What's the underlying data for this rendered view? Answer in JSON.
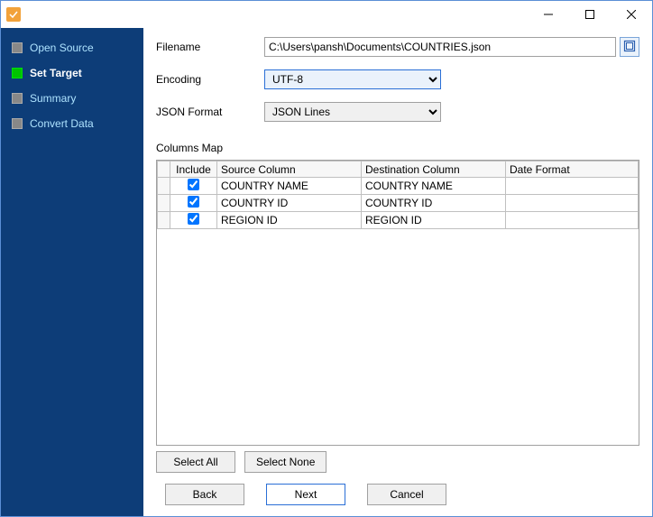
{
  "titlebar": {
    "title": ""
  },
  "sidebar": {
    "steps": [
      {
        "label": "Open Source",
        "active": false
      },
      {
        "label": "Set Target",
        "active": true
      },
      {
        "label": "Summary",
        "active": false
      },
      {
        "label": "Convert Data",
        "active": false
      }
    ]
  },
  "form": {
    "filename_label": "Filename",
    "filename_value": "C:\\Users\\pansh\\Documents\\COUNTRIES.json",
    "encoding_label": "Encoding",
    "encoding_value": "UTF-8",
    "json_format_label": "JSON Format",
    "json_format_value": "JSON Lines"
  },
  "columns_map": {
    "label": "Columns Map",
    "headers": {
      "include": "Include",
      "source": "Source Column",
      "destination": "Destination Column",
      "date_format": "Date Format"
    },
    "rows": [
      {
        "include": true,
        "source": "COUNTRY NAME",
        "destination": "COUNTRY NAME",
        "date_format": ""
      },
      {
        "include": true,
        "source": "COUNTRY ID",
        "destination": "COUNTRY ID",
        "date_format": ""
      },
      {
        "include": true,
        "source": "REGION ID",
        "destination": "REGION ID",
        "date_format": ""
      }
    ]
  },
  "buttons": {
    "select_all": "Select All",
    "select_none": "Select None",
    "back": "Back",
    "next": "Next",
    "cancel": "Cancel"
  }
}
